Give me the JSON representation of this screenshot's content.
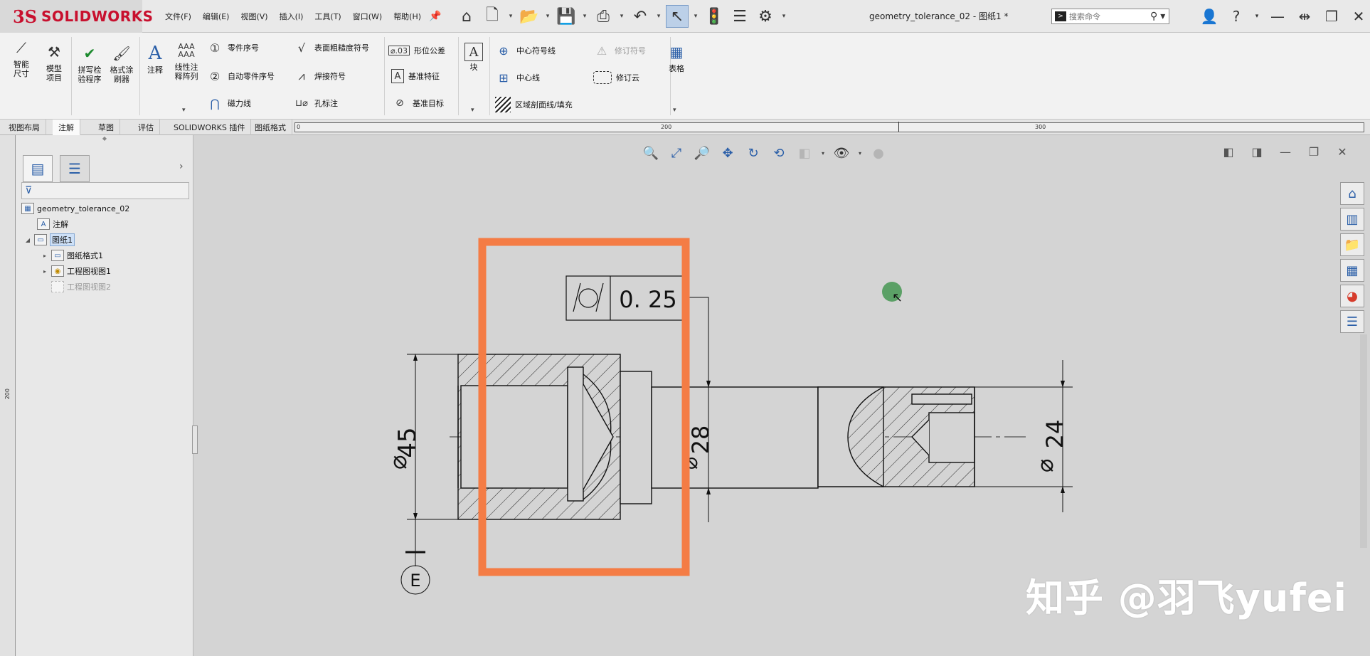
{
  "app": {
    "logo_ds": "3S",
    "logo_name": "SOLIDWORKS"
  },
  "menu": [
    "文件(F)",
    "编辑(E)",
    "视图(V)",
    "插入(I)",
    "工具(T)",
    "窗口(W)",
    "帮助(H)"
  ],
  "document_title": "geometry_tolerance_02 - 图纸1 *",
  "search": {
    "placeholder": "搜索命令"
  },
  "ribbon": {
    "smart_dimension": "智能尺寸",
    "model_items": "模型项目",
    "spell_check": "拼写检验程序",
    "format_painter": "格式涂刷器",
    "note": "注释",
    "linear_note_pattern": "线性注释阵列",
    "balloon": "零件序号",
    "auto_balloon": "自动零件序号",
    "magnetic_line": "磁力线",
    "surface_finish": "表面粗糙度符号",
    "weld_symbol": "焊接符号",
    "hole_callout": "孔标注",
    "geometric_tolerance": "形位公差",
    "datum_feature": "基准特征",
    "datum_target": "基准目标",
    "block": "块",
    "center_mark": "中心符号线",
    "centerline": "中心线",
    "area_hatch": "区域剖面线/填充",
    "revision_symbol": "修订符号",
    "revision_cloud": "修订云",
    "table": "表格"
  },
  "tabs": [
    "视图布局",
    "注解",
    "草图",
    "评估",
    "SOLIDWORKS 插件",
    "图纸格式"
  ],
  "ruler": {
    "top_labels": [
      "0",
      "200",
      "300"
    ],
    "left_label": "200"
  },
  "tree": {
    "root": "geometry_tolerance_02",
    "annotations": "注解",
    "sheet": "图纸1",
    "sheet_format": "图纸格式1",
    "view1": "工程图视图1",
    "view2": "工程图视图2"
  },
  "drawing": {
    "tolerance_value": "0. 25",
    "dim_left": "45",
    "dim_mid": "28",
    "dim_right": "24",
    "datum_label": "E",
    "highlight_color": "#f47c45"
  },
  "watermark": "知乎 @羽飞yufei"
}
